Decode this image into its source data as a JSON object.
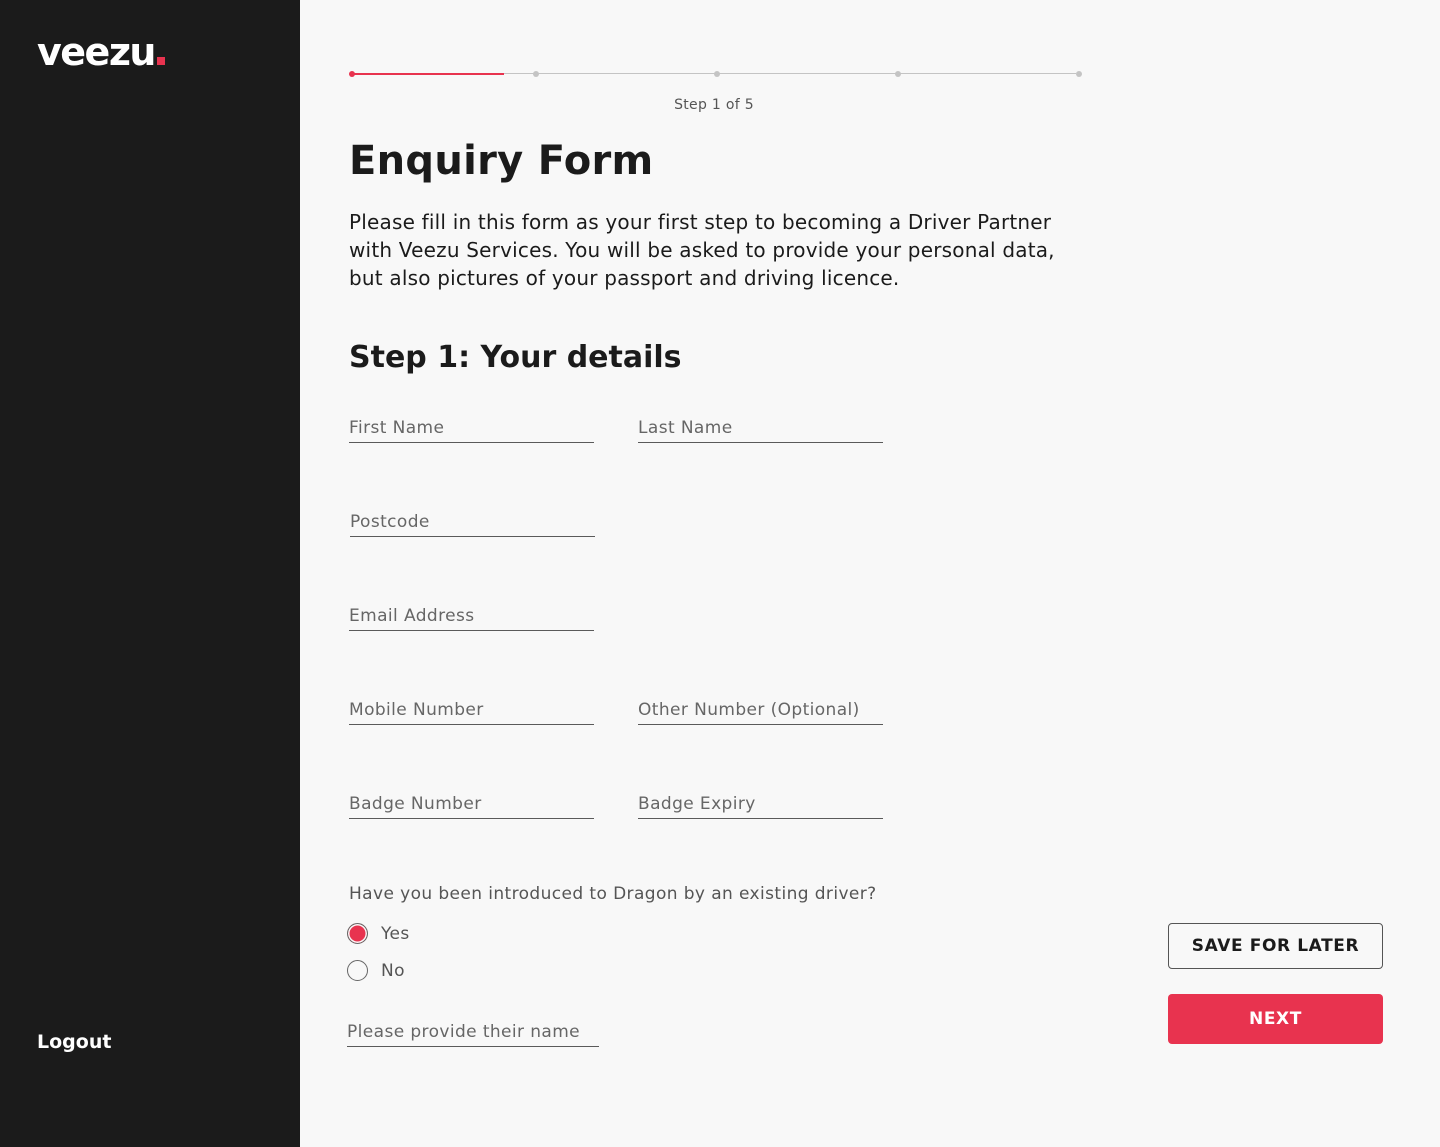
{
  "sidebar": {
    "logo": "veezu",
    "logo_accent_color": "#e8334f",
    "logout_label": "Logout"
  },
  "progress": {
    "current_step": 1,
    "total_steps": 5,
    "fill_fraction": 0.21,
    "label": "Step 1 of 5"
  },
  "header": {
    "title": "Enquiry Form",
    "intro": "Please fill in this form as your first step to becoming a Driver Partner with Veezu Services. You will be asked to provide your personal data, but also pictures of your passport and driving licence."
  },
  "form": {
    "section_title": "Step 1: Your details",
    "fields": {
      "first_name": {
        "placeholder": "First Name",
        "value": ""
      },
      "last_name": {
        "placeholder": "Last Name",
        "value": ""
      },
      "postcode": {
        "placeholder": "Postcode",
        "value": ""
      },
      "email": {
        "placeholder": "Email Address",
        "value": ""
      },
      "mobile": {
        "placeholder": "Mobile Number",
        "value": ""
      },
      "other_number": {
        "placeholder": "Other Number (Optional)",
        "value": ""
      },
      "badge_number": {
        "placeholder": "Badge Number",
        "value": ""
      },
      "badge_expiry": {
        "placeholder": "Badge Expiry",
        "value": ""
      },
      "referrer_name": {
        "placeholder": "Please provide their name",
        "value": ""
      }
    },
    "referral_question": "Have you been introduced to Dragon by an existing driver?",
    "referral_options": [
      {
        "label": "Yes",
        "checked": true
      },
      {
        "label": "No",
        "checked": false
      }
    ]
  },
  "actions": {
    "save_label": "SAVE FOR LATER",
    "next_label": "NEXT"
  },
  "colors": {
    "accent": "#e8334f",
    "sidebar_bg": "#1b1b1b",
    "page_bg": "#f8f8f8"
  }
}
